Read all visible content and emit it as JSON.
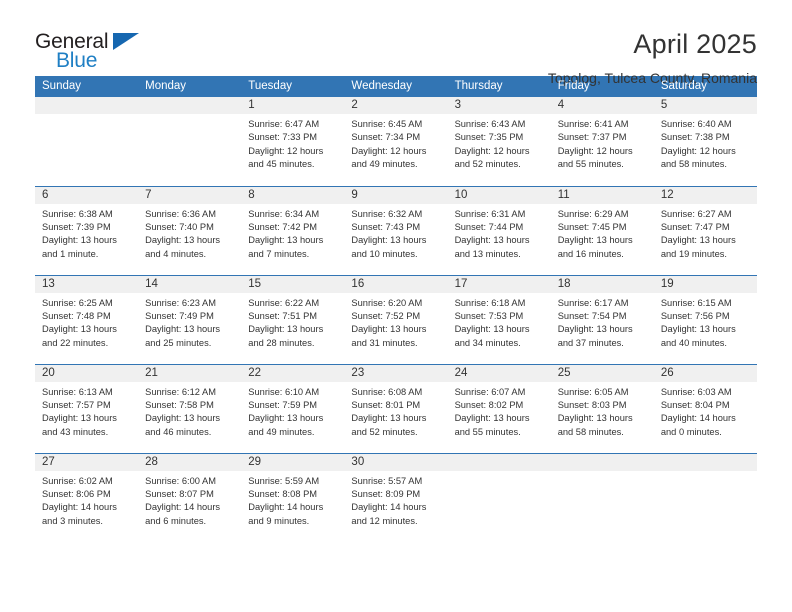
{
  "logo": {
    "word1": "General",
    "word2": "Blue",
    "triangle_color": "#1667b0",
    "blue": "#1f7fc4"
  },
  "header": {
    "title": "April 2025",
    "subtitle": "Topolog, Tulcea County, Romania",
    "accent_color": "#3275b4",
    "daynum_bg": "#f0f0f0"
  },
  "weekdays": [
    "Sunday",
    "Monday",
    "Tuesday",
    "Wednesday",
    "Thursday",
    "Friday",
    "Saturday"
  ],
  "weeks": [
    [
      {
        "day": "",
        "empty": true
      },
      {
        "day": "",
        "empty": true
      },
      {
        "day": "1",
        "sunrise": "Sunrise: 6:47 AM",
        "sunset": "Sunset: 7:33 PM",
        "daylight1": "Daylight: 12 hours",
        "daylight2": "and 45 minutes."
      },
      {
        "day": "2",
        "sunrise": "Sunrise: 6:45 AM",
        "sunset": "Sunset: 7:34 PM",
        "daylight1": "Daylight: 12 hours",
        "daylight2": "and 49 minutes."
      },
      {
        "day": "3",
        "sunrise": "Sunrise: 6:43 AM",
        "sunset": "Sunset: 7:35 PM",
        "daylight1": "Daylight: 12 hours",
        "daylight2": "and 52 minutes."
      },
      {
        "day": "4",
        "sunrise": "Sunrise: 6:41 AM",
        "sunset": "Sunset: 7:37 PM",
        "daylight1": "Daylight: 12 hours",
        "daylight2": "and 55 minutes."
      },
      {
        "day": "5",
        "sunrise": "Sunrise: 6:40 AM",
        "sunset": "Sunset: 7:38 PM",
        "daylight1": "Daylight: 12 hours",
        "daylight2": "and 58 minutes."
      }
    ],
    [
      {
        "day": "6",
        "sunrise": "Sunrise: 6:38 AM",
        "sunset": "Sunset: 7:39 PM",
        "daylight1": "Daylight: 13 hours",
        "daylight2": "and 1 minute."
      },
      {
        "day": "7",
        "sunrise": "Sunrise: 6:36 AM",
        "sunset": "Sunset: 7:40 PM",
        "daylight1": "Daylight: 13 hours",
        "daylight2": "and 4 minutes."
      },
      {
        "day": "8",
        "sunrise": "Sunrise: 6:34 AM",
        "sunset": "Sunset: 7:42 PM",
        "daylight1": "Daylight: 13 hours",
        "daylight2": "and 7 minutes."
      },
      {
        "day": "9",
        "sunrise": "Sunrise: 6:32 AM",
        "sunset": "Sunset: 7:43 PM",
        "daylight1": "Daylight: 13 hours",
        "daylight2": "and 10 minutes."
      },
      {
        "day": "10",
        "sunrise": "Sunrise: 6:31 AM",
        "sunset": "Sunset: 7:44 PM",
        "daylight1": "Daylight: 13 hours",
        "daylight2": "and 13 minutes."
      },
      {
        "day": "11",
        "sunrise": "Sunrise: 6:29 AM",
        "sunset": "Sunset: 7:45 PM",
        "daylight1": "Daylight: 13 hours",
        "daylight2": "and 16 minutes."
      },
      {
        "day": "12",
        "sunrise": "Sunrise: 6:27 AM",
        "sunset": "Sunset: 7:47 PM",
        "daylight1": "Daylight: 13 hours",
        "daylight2": "and 19 minutes."
      }
    ],
    [
      {
        "day": "13",
        "sunrise": "Sunrise: 6:25 AM",
        "sunset": "Sunset: 7:48 PM",
        "daylight1": "Daylight: 13 hours",
        "daylight2": "and 22 minutes."
      },
      {
        "day": "14",
        "sunrise": "Sunrise: 6:23 AM",
        "sunset": "Sunset: 7:49 PM",
        "daylight1": "Daylight: 13 hours",
        "daylight2": "and 25 minutes."
      },
      {
        "day": "15",
        "sunrise": "Sunrise: 6:22 AM",
        "sunset": "Sunset: 7:51 PM",
        "daylight1": "Daylight: 13 hours",
        "daylight2": "and 28 minutes."
      },
      {
        "day": "16",
        "sunrise": "Sunrise: 6:20 AM",
        "sunset": "Sunset: 7:52 PM",
        "daylight1": "Daylight: 13 hours",
        "daylight2": "and 31 minutes."
      },
      {
        "day": "17",
        "sunrise": "Sunrise: 6:18 AM",
        "sunset": "Sunset: 7:53 PM",
        "daylight1": "Daylight: 13 hours",
        "daylight2": "and 34 minutes."
      },
      {
        "day": "18",
        "sunrise": "Sunrise: 6:17 AM",
        "sunset": "Sunset: 7:54 PM",
        "daylight1": "Daylight: 13 hours",
        "daylight2": "and 37 minutes."
      },
      {
        "day": "19",
        "sunrise": "Sunrise: 6:15 AM",
        "sunset": "Sunset: 7:56 PM",
        "daylight1": "Daylight: 13 hours",
        "daylight2": "and 40 minutes."
      }
    ],
    [
      {
        "day": "20",
        "sunrise": "Sunrise: 6:13 AM",
        "sunset": "Sunset: 7:57 PM",
        "daylight1": "Daylight: 13 hours",
        "daylight2": "and 43 minutes."
      },
      {
        "day": "21",
        "sunrise": "Sunrise: 6:12 AM",
        "sunset": "Sunset: 7:58 PM",
        "daylight1": "Daylight: 13 hours",
        "daylight2": "and 46 minutes."
      },
      {
        "day": "22",
        "sunrise": "Sunrise: 6:10 AM",
        "sunset": "Sunset: 7:59 PM",
        "daylight1": "Daylight: 13 hours",
        "daylight2": "and 49 minutes."
      },
      {
        "day": "23",
        "sunrise": "Sunrise: 6:08 AM",
        "sunset": "Sunset: 8:01 PM",
        "daylight1": "Daylight: 13 hours",
        "daylight2": "and 52 minutes."
      },
      {
        "day": "24",
        "sunrise": "Sunrise: 6:07 AM",
        "sunset": "Sunset: 8:02 PM",
        "daylight1": "Daylight: 13 hours",
        "daylight2": "and 55 minutes."
      },
      {
        "day": "25",
        "sunrise": "Sunrise: 6:05 AM",
        "sunset": "Sunset: 8:03 PM",
        "daylight1": "Daylight: 13 hours",
        "daylight2": "and 58 minutes."
      },
      {
        "day": "26",
        "sunrise": "Sunrise: 6:03 AM",
        "sunset": "Sunset: 8:04 PM",
        "daylight1": "Daylight: 14 hours",
        "daylight2": "and 0 minutes."
      }
    ],
    [
      {
        "day": "27",
        "sunrise": "Sunrise: 6:02 AM",
        "sunset": "Sunset: 8:06 PM",
        "daylight1": "Daylight: 14 hours",
        "daylight2": "and 3 minutes."
      },
      {
        "day": "28",
        "sunrise": "Sunrise: 6:00 AM",
        "sunset": "Sunset: 8:07 PM",
        "daylight1": "Daylight: 14 hours",
        "daylight2": "and 6 minutes."
      },
      {
        "day": "29",
        "sunrise": "Sunrise: 5:59 AM",
        "sunset": "Sunset: 8:08 PM",
        "daylight1": "Daylight: 14 hours",
        "daylight2": "and 9 minutes."
      },
      {
        "day": "30",
        "sunrise": "Sunrise: 5:57 AM",
        "sunset": "Sunset: 8:09 PM",
        "daylight1": "Daylight: 14 hours",
        "daylight2": "and 12 minutes."
      },
      {
        "day": "",
        "empty": true
      },
      {
        "day": "",
        "empty": true
      },
      {
        "day": "",
        "empty": true
      }
    ]
  ]
}
